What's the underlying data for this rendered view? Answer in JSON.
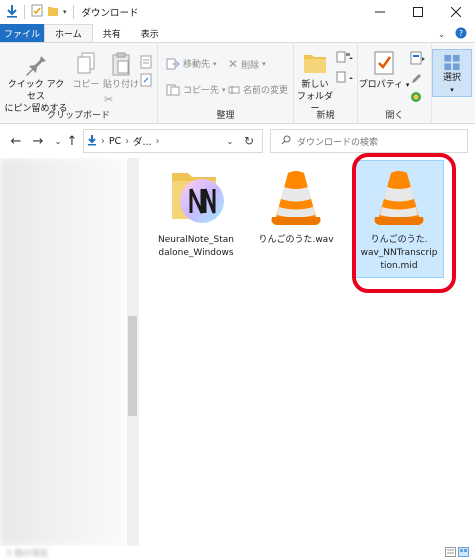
{
  "window": {
    "title": "ダウンロード"
  },
  "tabs": {
    "file": "ファイル",
    "home": "ホーム",
    "share": "共有",
    "view": "表示"
  },
  "ribbon": {
    "clipboard": {
      "pin_label": "クイック アクセス\nにピン留めする",
      "copy_label": "コピー",
      "paste_label": "貼り付け",
      "group_label": "クリップボード"
    },
    "organize": {
      "move_label": "移動先",
      "copy_to_label": "コピー先",
      "delete_label": "削除",
      "rename_label": "名前の変更",
      "group_label": "整理"
    },
    "new": {
      "new_folder_label": "新しい\nフォルダー",
      "group_label": "新規"
    },
    "open": {
      "properties_label": "プロパティ",
      "group_label": "開く"
    },
    "select": {
      "select_label": "選択"
    }
  },
  "address": {
    "segments": [
      "PC",
      "ダ..."
    ],
    "search_placeholder": "ダウンロードの検索"
  },
  "files": [
    {
      "name": "NeuralNote_Standalone_Windows",
      "name_lines": [
        "NeuralNote_Stan",
        "dalone_Windows"
      ],
      "icon": "neuralnote-folder-icon"
    },
    {
      "name": "りんごのうた.wav",
      "name_lines": [
        "りんごのうた.wav"
      ],
      "icon": "vlc-cone-icon"
    },
    {
      "name": "りんごのうた.wav_NNTranscription.mid",
      "name_lines": [
        "りんごのうた.",
        "wav_NNTranscrip",
        "tion.mid"
      ],
      "icon": "vlc-cone-icon"
    }
  ],
  "status": {
    "item_count": "3 個の項目"
  },
  "colors": {
    "accent": "#1f6fc5",
    "selection": "#cce8ff",
    "highlight": "#e8001c",
    "vlc_orange": "#ff8800"
  }
}
